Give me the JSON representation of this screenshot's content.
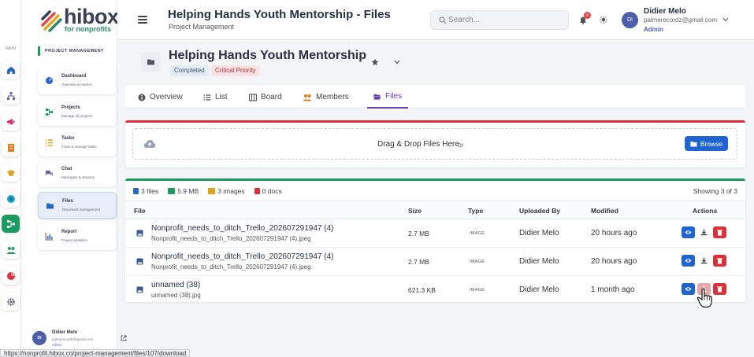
{
  "app": {
    "logo_word": "hibox",
    "logo_sub": "for nonprofits"
  },
  "rail": {
    "section_label": "MAIN"
  },
  "nav": {
    "section": "PROJECT MANAGEMENT",
    "items": [
      {
        "title": "Dashboard",
        "sub": "Overview & metrics",
        "icon": "dashboard-icon"
      },
      {
        "title": "Projects",
        "sub": "Manage all projects",
        "icon": "projects-icon"
      },
      {
        "title": "Tasks",
        "sub": "Track & manage tasks",
        "icon": "tasks-icon"
      },
      {
        "title": "Chat",
        "sub": "Messages & streams",
        "icon": "chat-icon"
      },
      {
        "title": "Files",
        "sub": "Document management",
        "icon": "files-icon"
      },
      {
        "title": "Report",
        "sub": "Project analytics",
        "icon": "report-icon"
      }
    ],
    "user": {
      "initials": "DI",
      "name": "Didier Melo",
      "email": "palmerecordz@gmail.com",
      "role": "Admin"
    }
  },
  "header": {
    "title": "Helping Hands Youth Mentorship - Files",
    "subtitle": "Project Management",
    "search_placeholder": "Search...",
    "notification_count": "9",
    "user": {
      "initials": "DI",
      "name": "Didier Melo",
      "email": "palmerecordz@gmail.com",
      "role": "Admin"
    }
  },
  "project": {
    "title": "Helping Hands Youth Mentorship",
    "status": "Completed",
    "priority": "Critical Priority"
  },
  "tabs": [
    {
      "label": "Overview",
      "icon": "info-icon"
    },
    {
      "label": "List",
      "icon": "list-icon"
    },
    {
      "label": "Board",
      "icon": "board-icon"
    },
    {
      "label": "Members",
      "icon": "members-icon"
    },
    {
      "label": "Files",
      "icon": "folder-icon",
      "active": true
    }
  ],
  "upload": {
    "drop_text": "Drag & Drop Files Here",
    "or_text": "or",
    "browse_label": "Browse"
  },
  "files": {
    "stats": {
      "files": "3 files",
      "size": "5.9 MB",
      "images": "3 images",
      "docs": "0 docs"
    },
    "showing": "Showing 3 of 3",
    "columns": [
      "File",
      "Size",
      "Type",
      "Uploaded By",
      "Modified",
      "Actions"
    ],
    "rows": [
      {
        "name": "Nonprofit_needs_to_ditch_Trello_202607291947 (4)",
        "filename": "Nonprofit_needs_to_ditch_Trello_202607291947 (4).jpeg",
        "size": "2.7 MB",
        "type": "IMAGE",
        "uploaded_by": "Didier Melo",
        "modified": "20 hours ago"
      },
      {
        "name": "Nonprofit_needs_to_ditch_Trello_202607291947 (4)",
        "filename": "Nonprofit_needs_to_ditch_Trello_202607291947 (4).jpeg",
        "size": "2.7 MB",
        "type": "IMAGE",
        "uploaded_by": "Didier Melo",
        "modified": "20 hours ago"
      },
      {
        "name": "unnamed (38)",
        "filename": "unnamed (38).jpg",
        "size": "621.3 KB",
        "type": "IMAGE",
        "uploaded_by": "Didier Melo",
        "modified": "1 month ago"
      }
    ]
  },
  "status_url": "https://nonprofit.hibox.co/project-management/files/107/download",
  "colors": {
    "accent_green": "#1d9a5f",
    "accent_purple": "#6a3fb8",
    "primary_blue": "#1f64d0",
    "danger_red": "#d9303a"
  }
}
